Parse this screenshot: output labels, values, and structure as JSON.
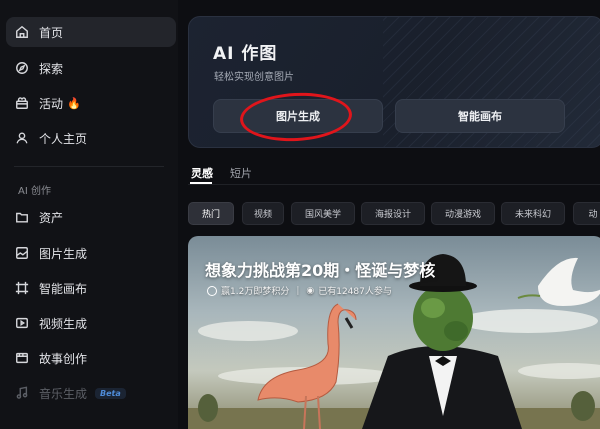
{
  "sidebar": {
    "items": [
      {
        "label": "首页",
        "icon": "home-icon",
        "active": true
      },
      {
        "label": "探索",
        "icon": "compass-icon"
      },
      {
        "label": "活动",
        "icon": "gift-icon",
        "badge": "🔥"
      },
      {
        "label": "个人主页",
        "icon": "user-icon"
      }
    ],
    "section_title": "AI 创作",
    "create_items": [
      {
        "label": "资产",
        "icon": "folder-icon"
      },
      {
        "label": "图片生成",
        "icon": "image-gen-icon"
      },
      {
        "label": "智能画布",
        "icon": "canvas-icon"
      },
      {
        "label": "视频生成",
        "icon": "video-icon"
      },
      {
        "label": "故事创作",
        "icon": "story-icon"
      },
      {
        "label": "音乐生成",
        "icon": "music-icon",
        "badge": "Beta",
        "disabled": true
      }
    ]
  },
  "hero": {
    "title": "AI 作图",
    "subtitle": "轻松实现创意图片",
    "btn_generate": "图片生成",
    "btn_canvas": "智能画布"
  },
  "tabs": [
    {
      "label": "灵感",
      "active": true
    },
    {
      "label": "短片"
    }
  ],
  "chips": [
    "热门",
    "视频",
    "国风美学",
    "海报设计",
    "动漫游戏",
    "未来科幻",
    "动"
  ],
  "banner": {
    "title": "想象力挑战第20期・怪诞与梦核",
    "reward": "赢1.2万即梦积分",
    "participants": "已有12487人参与"
  },
  "colors": {
    "background": "#0d0e12",
    "highlight_circle": "#e0151b",
    "beta": "#4e8bd8"
  }
}
